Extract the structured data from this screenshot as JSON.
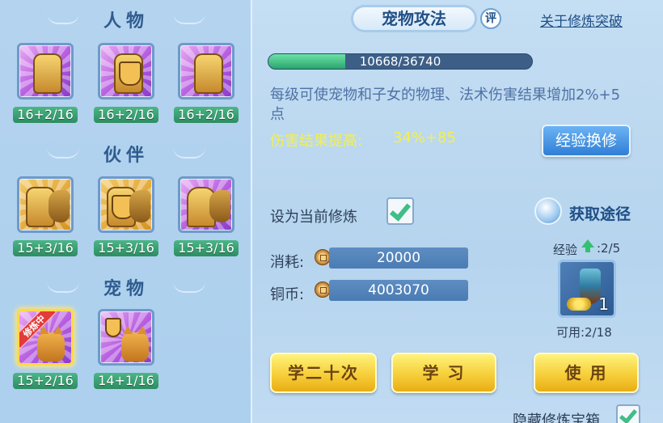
{
  "sections": {
    "character": "人物",
    "partner": "伙伴",
    "pet": "宠物"
  },
  "slots": {
    "character": [
      {
        "level": "16+2/16",
        "icon": "character-meditate-icon"
      },
      {
        "level": "16+2/16",
        "icon": "character-armor-icon"
      },
      {
        "level": "16+2/16",
        "icon": "character-stance-icon"
      }
    ],
    "partner": [
      {
        "level": "15+3/16",
        "icon": "partner-sword-icon"
      },
      {
        "level": "15+3/16",
        "icon": "partner-shield-icon"
      },
      {
        "level": "15+3/16",
        "icon": "partner-palm-icon"
      }
    ],
    "pet": [
      {
        "level": "15+2/16",
        "icon": "pet-attack-icon",
        "ribbon": "修炼中"
      },
      {
        "level": "14+1/16",
        "icon": "pet-defense-icon"
      }
    ]
  },
  "detail": {
    "title": "宠物攻法",
    "rate_badge": "评",
    "breakthrough_link": "关于修炼突破",
    "progress_text": "10668/36740",
    "progress_fraction": 0.29,
    "description": "每级可使宠物和子女的物理、法术伤害结果增加2%+5点",
    "effect_label": "伤害结果提高:",
    "effect_value": "34%+85",
    "exchange_button": "经验换修",
    "set_current_label": "设为当前修炼",
    "source_text": "获取途径",
    "cost_label": "消耗:",
    "cost_value": "20000",
    "copper_label": "铜币:",
    "copper_value": "4003070",
    "exp_label": "经验",
    "exp_value": ":2/5",
    "item_count": "1",
    "available": "可用:2/18",
    "learn_twenty_button": "学二十次",
    "learn_button": "学 习",
    "use_button": "使 用",
    "hide_box_label": "隐藏修炼宝箱"
  },
  "colors": {
    "accent_green": "#3fbe87",
    "effect_yellow": "#f4ef4a",
    "title_blue": "#1f4f86"
  }
}
